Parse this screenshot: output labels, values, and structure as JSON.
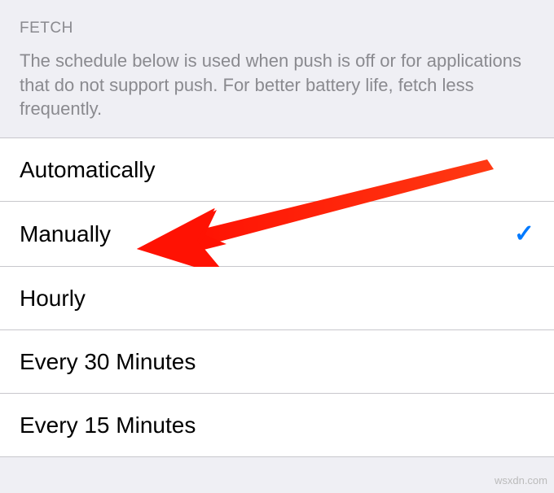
{
  "header": {
    "title": "FETCH",
    "description": "The schedule below is used when push is off or for applications that do not support push. For better battery life, fetch less frequently."
  },
  "options": [
    {
      "label": "Automatically",
      "selected": false
    },
    {
      "label": "Manually",
      "selected": true
    },
    {
      "label": "Hourly",
      "selected": false
    },
    {
      "label": "Every 30 Minutes",
      "selected": false
    },
    {
      "label": "Every 15 Minutes",
      "selected": false
    }
  ],
  "watermark": "wsxdn.com"
}
